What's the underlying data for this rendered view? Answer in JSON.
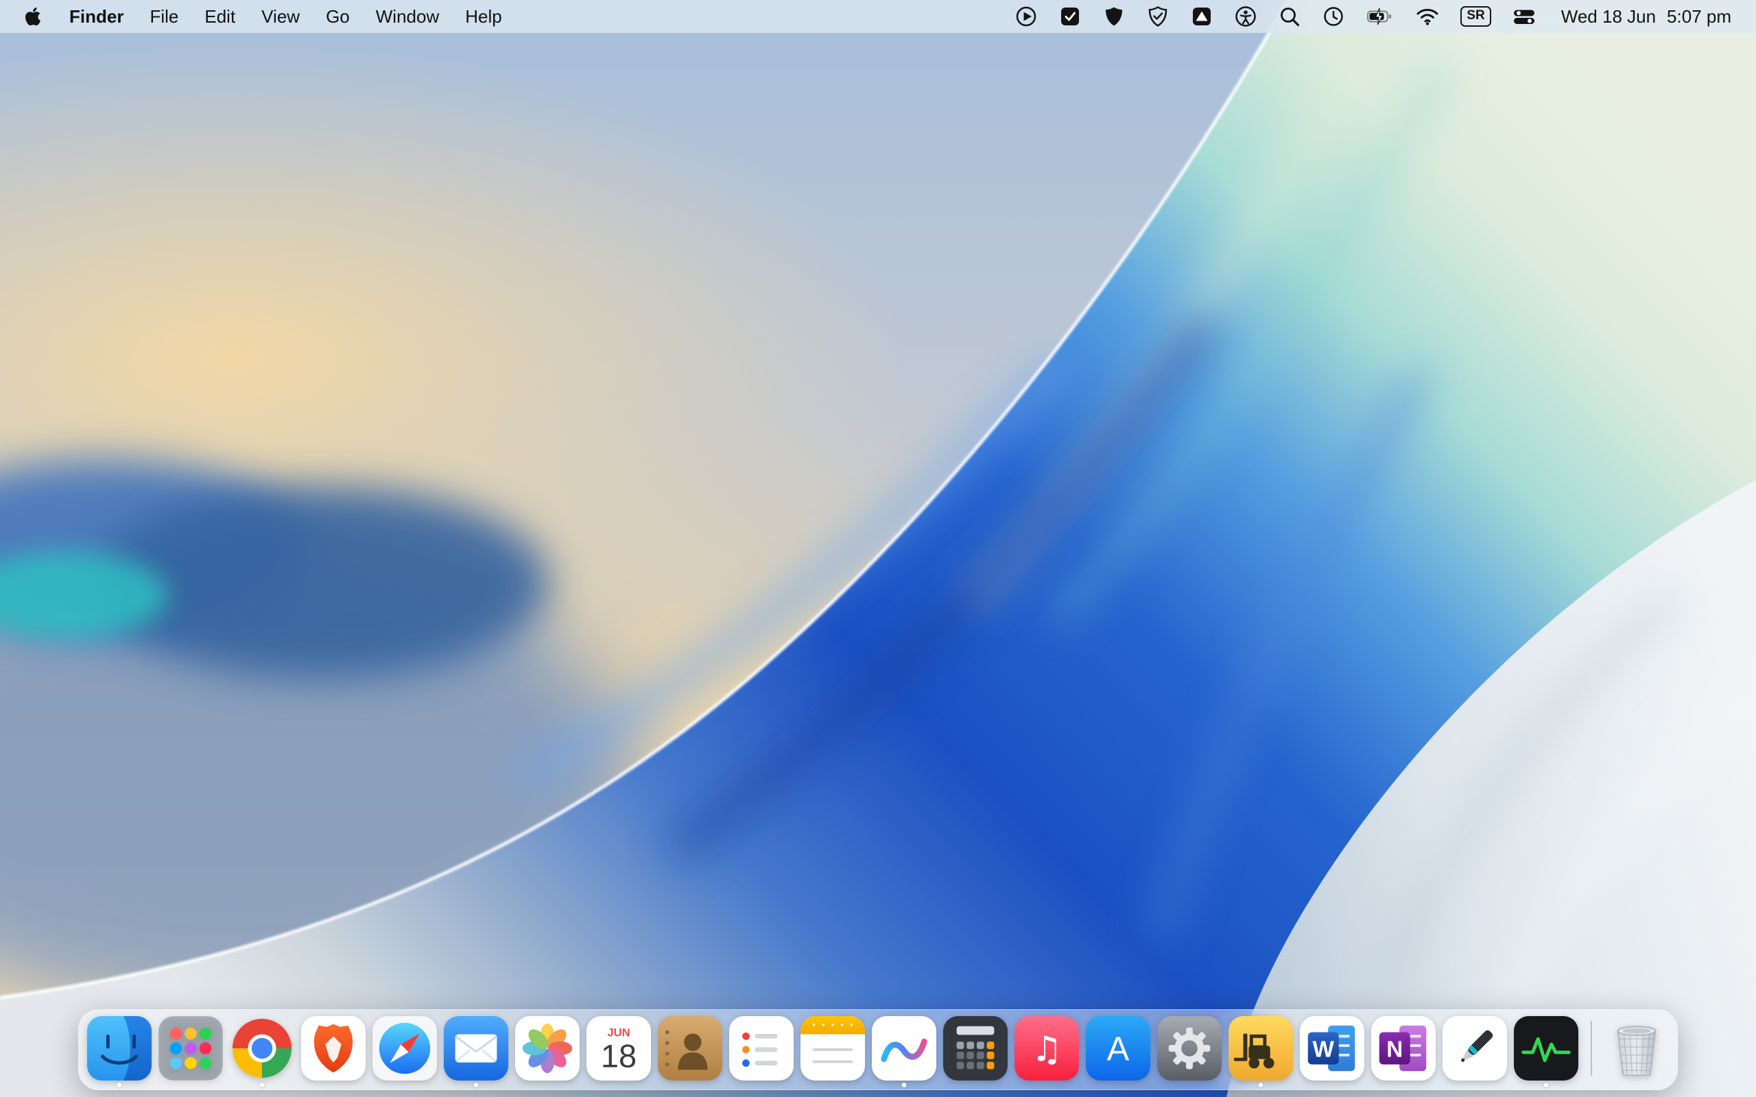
{
  "menu_bar": {
    "app_name": "Finder",
    "menus": [
      "File",
      "Edit",
      "View",
      "Go",
      "Window",
      "Help"
    ],
    "status_icons": [
      "play-circle",
      "input-source-check",
      "shield",
      "shield-check",
      "upload-box",
      "accessibility",
      "spotlight-search",
      "clock-recents",
      "battery-charging",
      "wifi",
      "keyboard-layout-badge",
      "control-center"
    ],
    "keyboard_badge": "SR",
    "date": "Wed 18 Jun",
    "time": "5:07 pm"
  },
  "dock": {
    "apps": [
      {
        "name": "Finder",
        "icon": "finder-icon",
        "running": true
      },
      {
        "name": "Launchpad",
        "icon": "launchpad-icon",
        "running": false
      },
      {
        "name": "Google Chrome",
        "icon": "chrome-icon",
        "running": true
      },
      {
        "name": "Brave Browser",
        "icon": "brave-icon",
        "running": false
      },
      {
        "name": "Safari",
        "icon": "safari-icon",
        "running": false
      },
      {
        "name": "Mail",
        "icon": "mail-icon",
        "running": true
      },
      {
        "name": "Photos",
        "icon": "photos-icon",
        "running": false
      },
      {
        "name": "Calendar",
        "icon": "calendar-icon",
        "running": false,
        "month": "JUN",
        "day": "18"
      },
      {
        "name": "Contacts",
        "icon": "contacts-icon",
        "running": false
      },
      {
        "name": "Reminders",
        "icon": "reminders-icon",
        "running": false
      },
      {
        "name": "Notes",
        "icon": "notes-icon",
        "running": false
      },
      {
        "name": "Freeform",
        "icon": "freeform-icon",
        "running": true
      },
      {
        "name": "Calculator",
        "icon": "calculator-icon",
        "running": false
      },
      {
        "name": "Music",
        "icon": "music-icon",
        "running": false,
        "glyph": "♫"
      },
      {
        "name": "App Store",
        "icon": "app-store-icon",
        "running": false,
        "glyph": "A"
      },
      {
        "name": "System Settings",
        "icon": "system-settings-icon",
        "running": false
      },
      {
        "name": "ForkLift",
        "icon": "forklift-icon",
        "running": true
      },
      {
        "name": "Microsoft Word",
        "icon": "word-icon",
        "running": false,
        "glyph": "W"
      },
      {
        "name": "Microsoft OneNote",
        "icon": "onenote-icon",
        "running": false,
        "glyph": "N"
      },
      {
        "name": "Pen Notes",
        "icon": "pen-icon",
        "running": false
      },
      {
        "name": "System Monitor",
        "icon": "activity-monitor-icon",
        "running": true
      }
    ],
    "trash": {
      "name": "Trash",
      "icon": "trash-icon"
    }
  },
  "wallpaper": {
    "style": "macOS abstract silk wave",
    "palette": {
      "sky": "#a6bedb",
      "peach": "#f2d9ab",
      "wave_blue": "#1c50c2",
      "aqua": "#a7dcd6",
      "ice": "#e4e8ec",
      "teal_hill": "#2fc0c3"
    }
  }
}
